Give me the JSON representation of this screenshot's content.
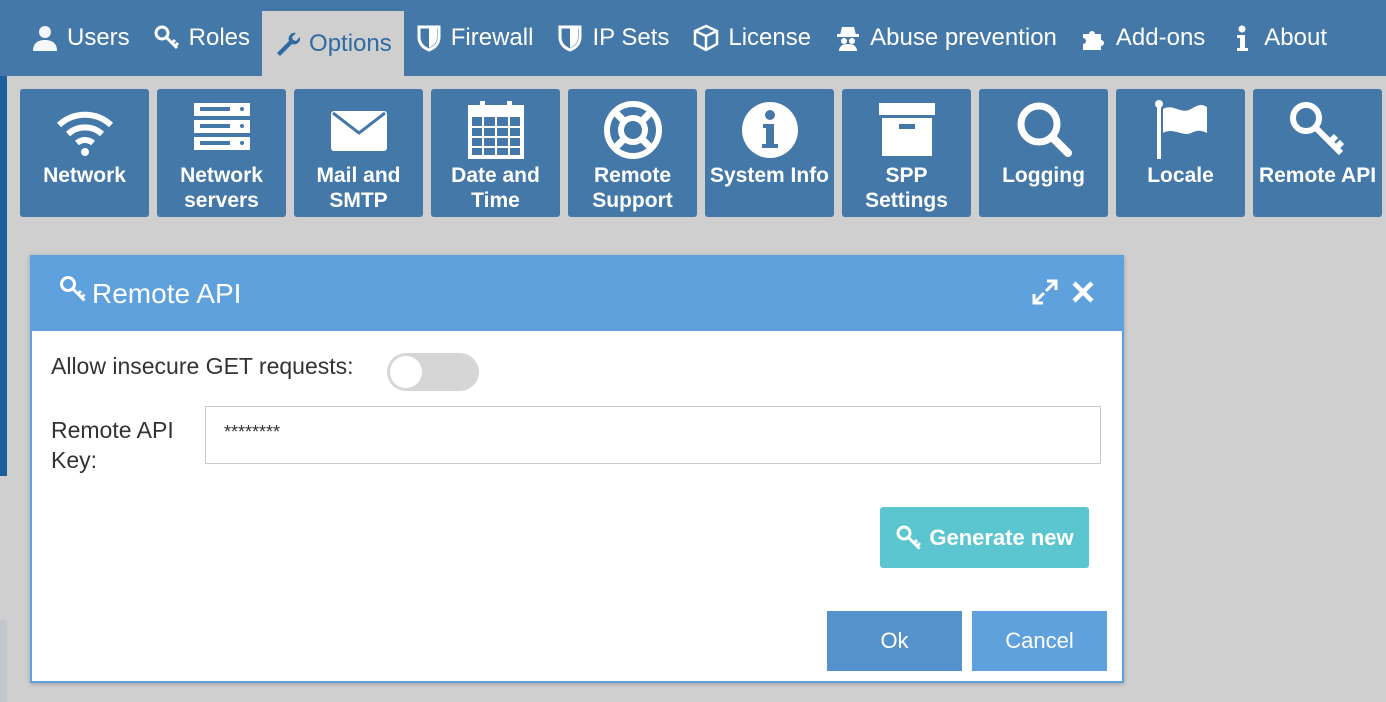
{
  "nav": {
    "tabs": [
      {
        "label": "Users",
        "icon": "user-icon"
      },
      {
        "label": "Roles",
        "icon": "key-icon"
      },
      {
        "label": "Options",
        "icon": "wrench-icon",
        "active": true
      },
      {
        "label": "Firewall",
        "icon": "shield-icon"
      },
      {
        "label": "IP Sets",
        "icon": "shield-icon"
      },
      {
        "label": "License",
        "icon": "box-icon"
      },
      {
        "label": "Abuse prevention",
        "icon": "spy-icon"
      },
      {
        "label": "Add-ons",
        "icon": "puzzle-icon"
      },
      {
        "label": "About",
        "icon": "info-icon"
      }
    ]
  },
  "tiles": [
    {
      "label": "Network",
      "icon": "wifi-icon"
    },
    {
      "label": "Network servers",
      "icon": "server-icon"
    },
    {
      "label": "Mail and SMTP",
      "icon": "envelope-icon"
    },
    {
      "label": "Date and Time",
      "icon": "calendar-icon"
    },
    {
      "label": "Remote Support",
      "icon": "lifebuoy-icon"
    },
    {
      "label": "System Info",
      "icon": "info-circle-icon"
    },
    {
      "label": "SPP Settings",
      "icon": "archive-icon"
    },
    {
      "label": "Logging",
      "icon": "magnifier-icon"
    },
    {
      "label": "Locale",
      "icon": "flag-icon"
    },
    {
      "label": "Remote API",
      "icon": "key-icon"
    }
  ],
  "dialog": {
    "title": "Remote API",
    "allow_get_label": "Allow insecure GET requests:",
    "allow_get_enabled": false,
    "api_key_label": "Remote API Key:",
    "api_key_value": "********",
    "generate_label": "Generate new",
    "ok_label": "Ok",
    "cancel_label": "Cancel"
  },
  "colors": {
    "nav_bg": "#4478a8",
    "dialog_header": "#5ea1dd",
    "generate_btn": "#5bc6d0"
  }
}
